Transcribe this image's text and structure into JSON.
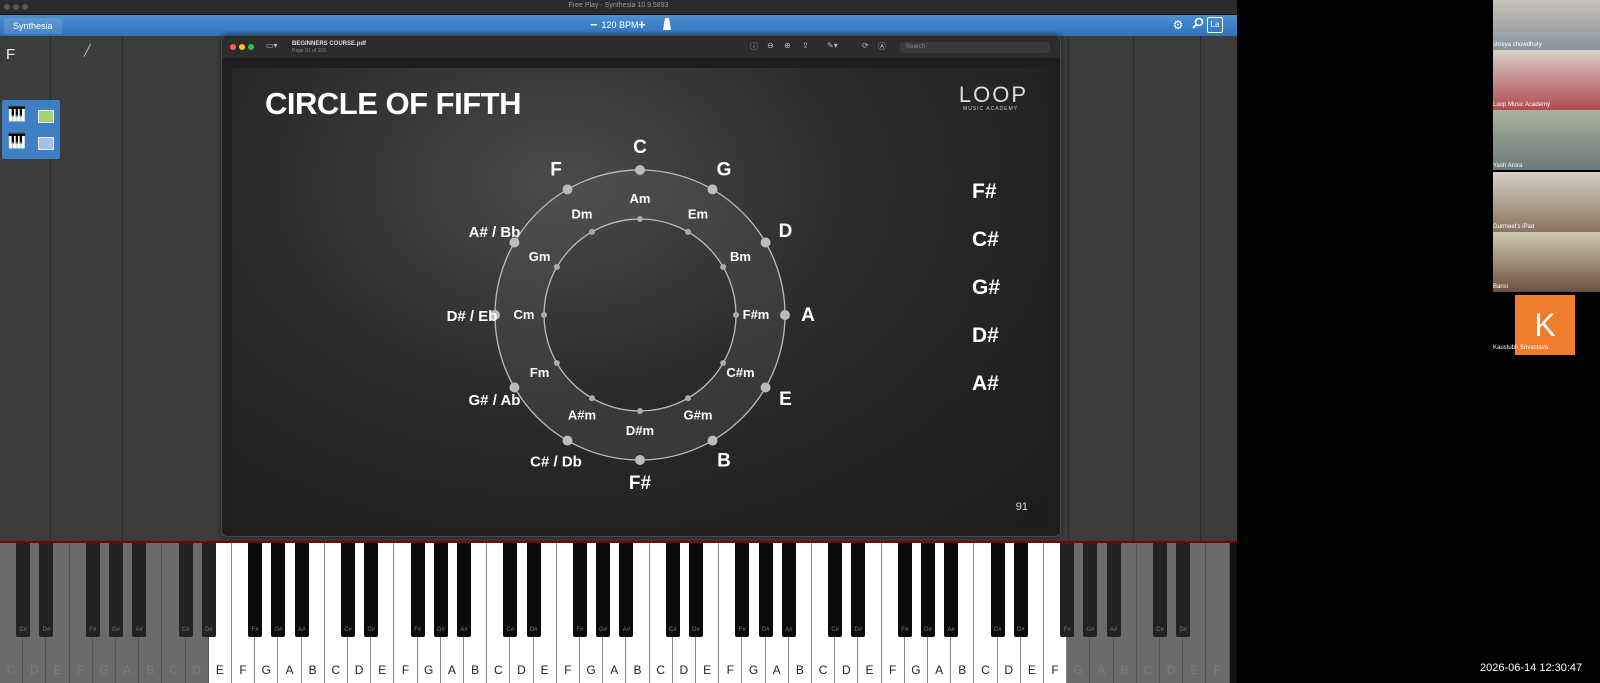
{
  "window": {
    "title": "Free Play - Synthesia 10.9.5893"
  },
  "synthesia": {
    "tab_label": "Synthesia",
    "bpm_label": "120 BPM",
    "minus": "−",
    "plus": "+",
    "note_label": "F",
    "right_button_label": "La"
  },
  "pdf": {
    "doc_name": "BEGINNERS COURSE.pdf",
    "page_info": "Page 91 of 103",
    "search_placeholder": "Search"
  },
  "slide": {
    "title": "CIRCLE OF FIFTH",
    "logo_main": "LOOP",
    "logo_sub": "MUSIC ACADEMY",
    "page_number": "91",
    "major_keys": [
      "C",
      "G",
      "D",
      "A",
      "E",
      "B",
      "F#",
      "C# / Db",
      "G# / Ab",
      "D# / Eb",
      "A# / Bb",
      "F"
    ],
    "minor_keys": [
      "Am",
      "Em",
      "Bm",
      "F#m",
      "C#m",
      "G#m",
      "D#m",
      "A#m",
      "Fm",
      "Cm",
      "Gm",
      "Dm"
    ],
    "sharps": [
      "F#",
      "C#",
      "G#",
      "D#",
      "A#"
    ]
  },
  "keyboard": {
    "white_notes": [
      "C",
      "D",
      "E",
      "F",
      "G",
      "A",
      "B"
    ],
    "black_notes": [
      "C#",
      "D#",
      "F#",
      "G#",
      "A#"
    ]
  },
  "participants": [
    {
      "name": "shreya chowdhury"
    },
    {
      "name": "Loop Music Academy"
    },
    {
      "name": "Yash Arora"
    },
    {
      "name": "Gurmeet's iPad"
    },
    {
      "name": "Bansi"
    },
    {
      "name": "Kaustubh Srivastava",
      "initial": "K"
    }
  ],
  "clock": "2026-06-14  12:30:47",
  "colors": {
    "synthesia_blue": "#3a80c8",
    "avatar_orange": "#f07c2e"
  }
}
